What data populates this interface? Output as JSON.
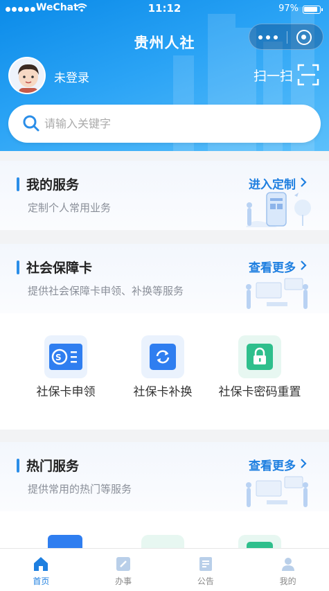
{
  "status": {
    "carrier": "WeChat",
    "time": "11:12",
    "battery": "97%"
  },
  "header": {
    "title": "贵州人社",
    "login_text": "未登录",
    "scan_label": "扫一扫"
  },
  "search": {
    "placeholder": "请输入关键字"
  },
  "my_service": {
    "title": "我的服务",
    "subtitle": "定制个人常用业务",
    "action": "进入定制"
  },
  "social_card": {
    "title": "社会保障卡",
    "subtitle": "提供社会保障卡申领、补换等服务",
    "action": "查看更多",
    "items": [
      {
        "label": "社保卡申领",
        "icon": "card-apply-icon",
        "color": "#2f7ef0"
      },
      {
        "label": "社保卡补换",
        "icon": "card-replace-icon",
        "color": "#2f7ef0"
      },
      {
        "label": "社保卡密码重置",
        "icon": "lock-icon",
        "color": "#2fbf8c"
      }
    ]
  },
  "hot_service": {
    "title": "热门服务",
    "subtitle": "提供常用的热门等服务",
    "action": "查看更多"
  },
  "tabs": [
    {
      "label": "首页",
      "icon": "home-icon",
      "active": true
    },
    {
      "label": "办事",
      "icon": "edit-icon",
      "active": false
    },
    {
      "label": "公告",
      "icon": "notice-icon",
      "active": false
    },
    {
      "label": "我的",
      "icon": "user-icon",
      "active": false
    }
  ],
  "colors": {
    "primary": "#1e7fe0",
    "header_start": "#0a8ae8",
    "header_end": "#5cc0fb",
    "green": "#2fbf8c"
  }
}
